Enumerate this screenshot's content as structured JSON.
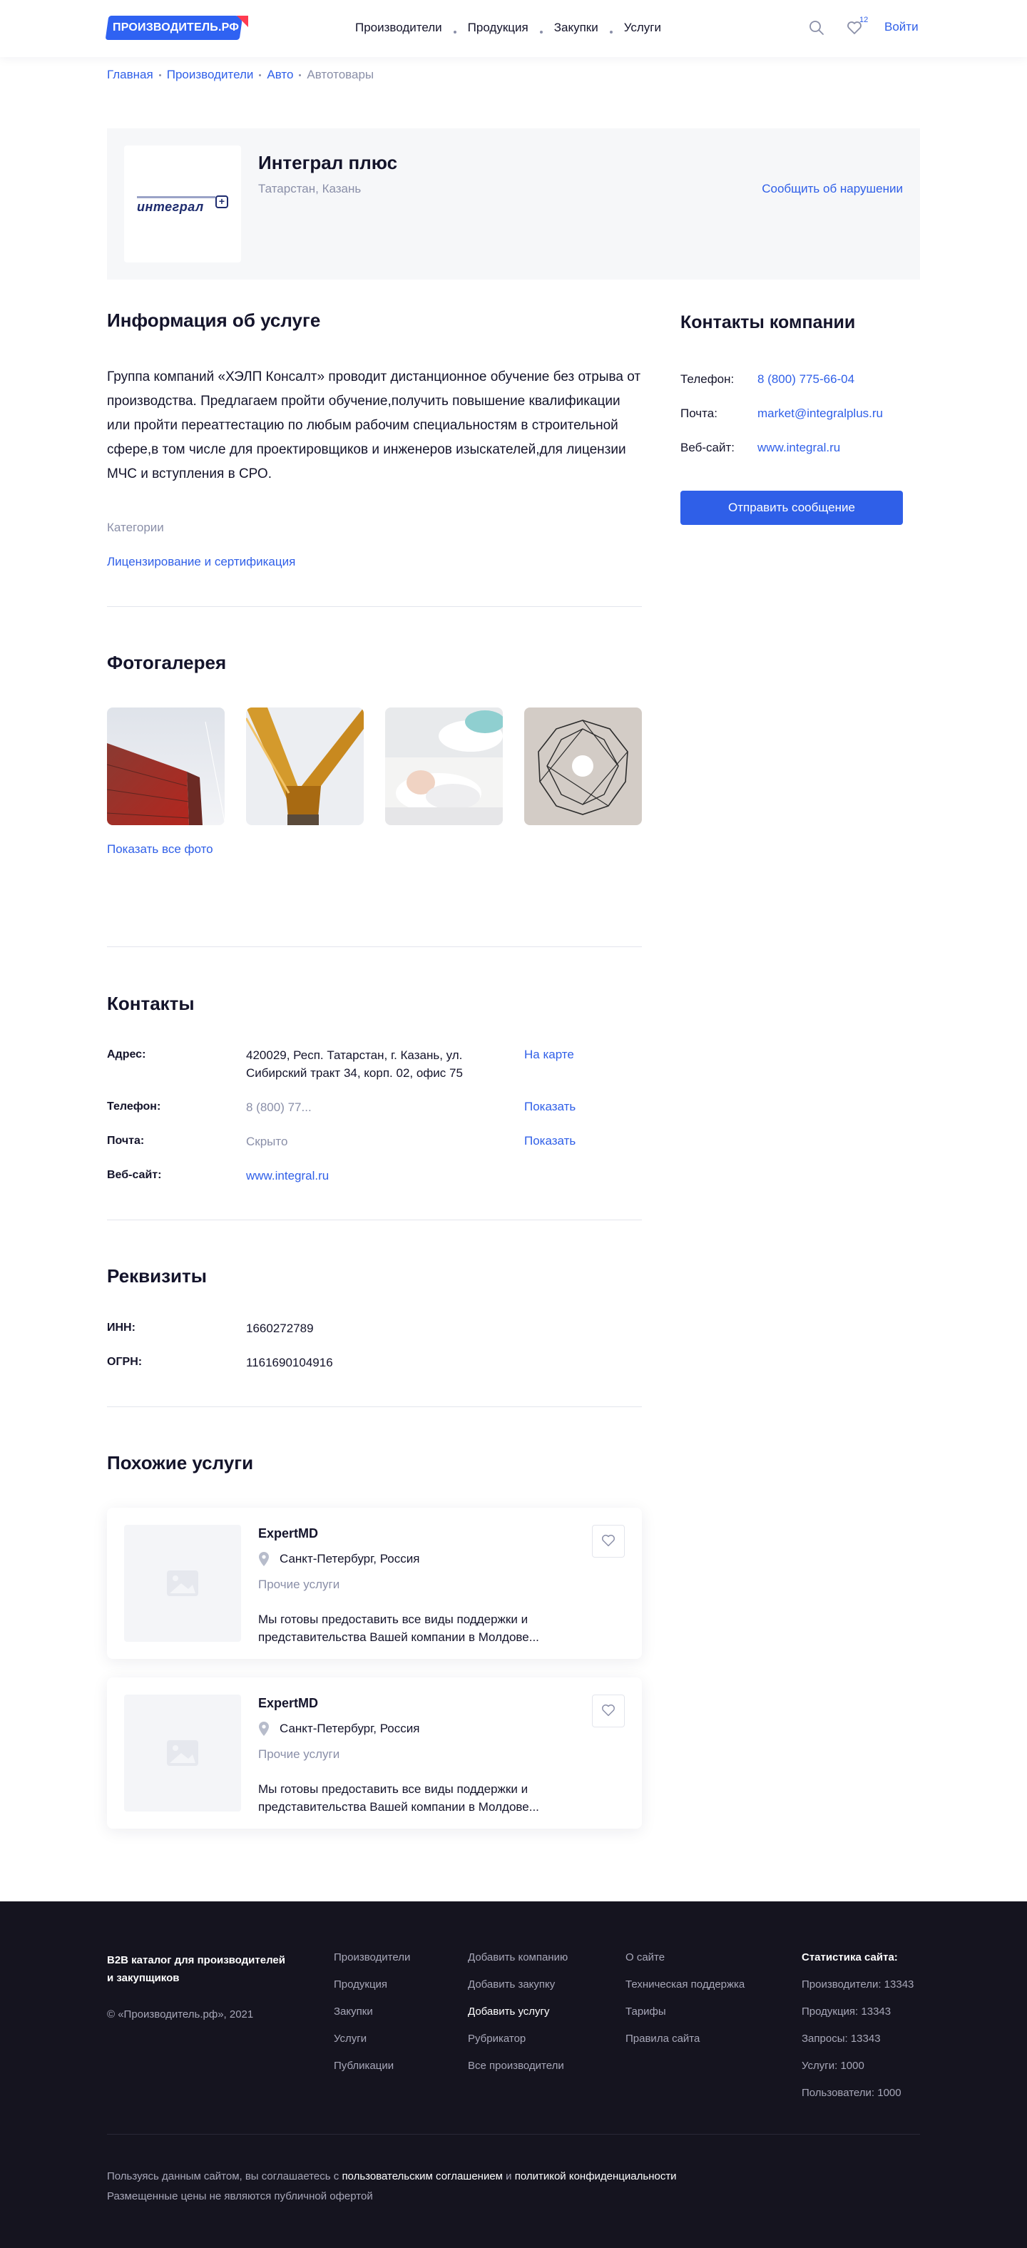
{
  "header": {
    "logo_text": "ПРОИЗВОДИТЕЛЬ.РФ",
    "nav": [
      "Производители",
      "Продукция",
      "Закупки",
      "Услуги"
    ],
    "favorites_count": "12",
    "login": "Войти"
  },
  "breadcrumbs": [
    "Главная",
    "Производители",
    "Авто",
    "Автотовары"
  ],
  "company": {
    "logo_text": "интеграл",
    "name": "Интеграл плюс",
    "region": "Татарстан, Казань",
    "report_link": "Сообщить об нарушении"
  },
  "about": {
    "title": "Информация об услуге",
    "text": "Группа компаний «ХЭЛП Консалт» проводит дистанционное обучение без отрыва от производства. Предлагаем пройти  обучение,получить повышение квалификации  или  пройти  переаттестацию по любым рабочим специальностям в строительной сфере,в том числе для проектировщиков и инженеров изыскателей,для лицензии  МЧС и  вступления в СРО.",
    "categories_label": "Категории",
    "category": "Лицензирование и  сертификация"
  },
  "company_contacts": {
    "title": "Контакты компании",
    "phone_label": "Телефон:",
    "phone": "8 (800) 775-66-04",
    "email_label": "Почта:",
    "email": "market@integralplus.ru",
    "site_label": "Веб-сайт:",
    "site": "www.integral.ru",
    "send_button": "Отправить сообщение"
  },
  "gallery": {
    "title": "Фотогалерея",
    "show_all": "Показать все фото"
  },
  "contacts": {
    "title": "Контакты",
    "address_label": "Адрес:",
    "address_line1": "420029, Респ. Татарстан, г. Казань, ул.",
    "address_line2": "Сибирский тракт 34, корп. 02, офис 75",
    "map_link": "На карте",
    "phone_label": "Телефон:",
    "phone": "8 (800) 77...",
    "phone_show": "Показать",
    "email_label": "Почта:",
    "email": "Скрыто",
    "email_show": "Показать",
    "site_label": "Веб-сайт:",
    "site": "www.integral.ru"
  },
  "requisites": {
    "title": "Реквизиты",
    "inn_label": "ИНН:",
    "inn": "1660272789",
    "ogrn_label": "ОГРН:",
    "ogrn": "1161690104916"
  },
  "similar": {
    "title": "Похожие услуги",
    "items": [
      {
        "name": "ExpertMD",
        "location": "Санкт-Петербург, Россия",
        "category": "Прочие услуги",
        "desc1": "Мы готовы предоставить все виды поддержки  и",
        "desc2": "представительства Вашей компании  в Молдове..."
      },
      {
        "name": "ExpertMD",
        "location": "Санкт-Петербург, Россия",
        "category": "Прочие услуги",
        "desc1": "Мы готовы предоставить все виды поддержки и",
        "desc2": "представительства Вашей компании в Молдове..."
      }
    ]
  },
  "footer": {
    "about_line1": "B2B каталог для производителей",
    "about_line2": "и закупщиков",
    "copyright": "© «Производитель.рф», 2021",
    "col1": [
      "Производители",
      "Продукция",
      "Закупки",
      "Услуги",
      "Публикации"
    ],
    "col2": [
      "Добавить компанию",
      "Добавить закупку",
      "Добавить услугу",
      "Рубрикатор",
      "Все производители"
    ],
    "col3": [
      "О сайте",
      "Техническая поддержка",
      "Тарифы",
      "Правила сайта"
    ],
    "stats_title": "Статистика сайта:",
    "stats": [
      "Производители: 13343",
      "Продукция: 13343",
      "Запросы: 13343",
      "Услуги: 1000",
      "Пользователи: 1000"
    ],
    "legal_prefix": "Пользуясь данным сайтом, вы соглашаетесь с",
    "legal_link1": "пользовательским соглашением",
    "legal_and": "и",
    "legal_link2": "политикой конфиденциальности",
    "legal_line2": "Размещенные цены не являются публичной офертой"
  }
}
